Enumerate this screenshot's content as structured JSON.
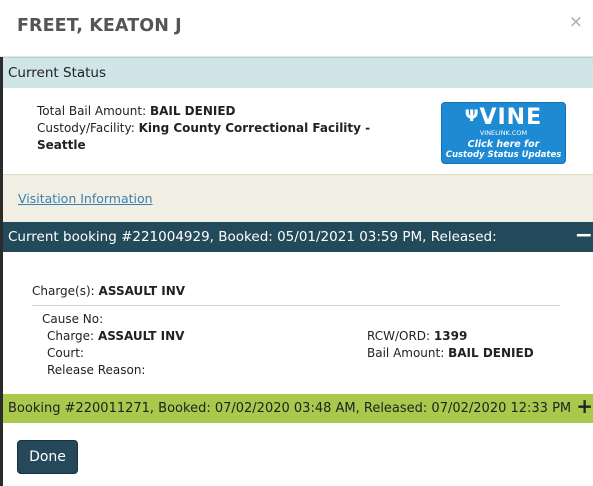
{
  "header": {
    "title": "FREET, KEATON J",
    "close_glyph": "×"
  },
  "current_status": {
    "heading": "Current Status",
    "total_bail_label": "Total Bail Amount:",
    "total_bail_value": "BAIL DENIED",
    "custody_label": "Custody/Facility:",
    "custody_value_line1": "King County Correctional Facility -",
    "custody_value_line2": "Seattle"
  },
  "vine": {
    "logo": "VINE",
    "url": "VINELINK.COM",
    "cta_line1": "Click here for",
    "cta_line2": "Custody Status Updates",
    "icon": "vine-logo"
  },
  "visitation": {
    "link": "Visitation Information"
  },
  "current_booking": {
    "heading": "Current booking #221004929, Booked: 05/01/2021 03:59 PM, Released:",
    "toggle": "−",
    "charges_label": "Charge(s):",
    "charges_value": "ASSAULT INV",
    "cause_no_label": "Cause No:",
    "charge_label": "Charge:",
    "charge_value": "ASSAULT INV",
    "court_label": "Court:",
    "release_reason_label": "Release Reason:",
    "rcw_label": "RCW/ORD:",
    "rcw_value": "1399",
    "bail_label": "Bail Amount:",
    "bail_value": "BAIL DENIED"
  },
  "past_booking": {
    "heading": "Booking #220011271, Booked: 07/02/2020 03:48 AM, Released: 07/02/2020 12:33 PM",
    "toggle": "+"
  },
  "footer": {
    "done_label": "Done"
  },
  "colors": {
    "status_bar": "#cfe5e8",
    "booking_bar": "#234a5a",
    "past_booking_bar": "#a8c94c",
    "done_button": "#25495a",
    "link": "#3a7fb2",
    "vine_blue": "#1e8ad3"
  }
}
